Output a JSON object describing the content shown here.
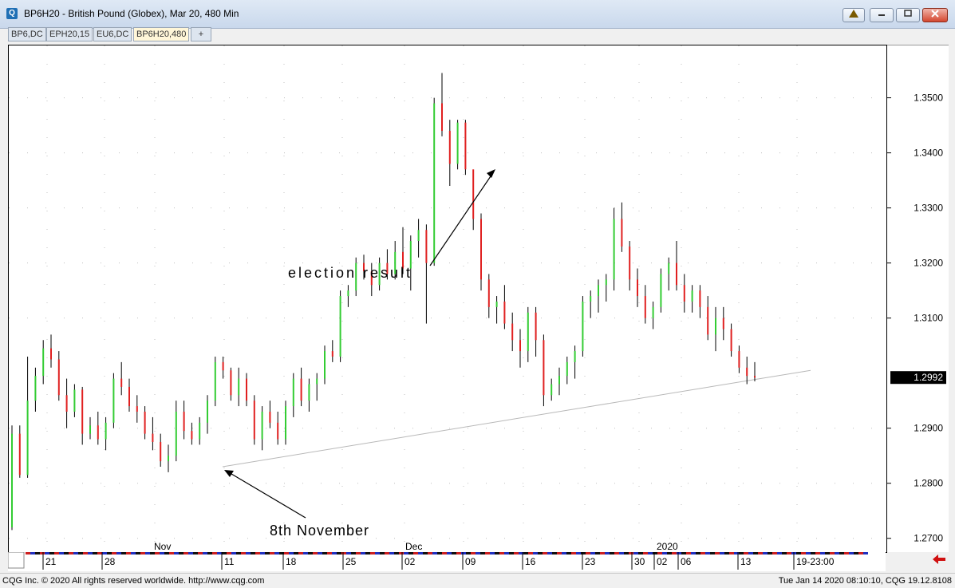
{
  "window": {
    "title": "BP6H20 - British Pound (Globex), Mar 20, 480 Min",
    "tabs": [
      "BP6,DC",
      "EPH20,15",
      "EU6,DC",
      "BP6H20,480"
    ],
    "add_tab": "+"
  },
  "chart_data": {
    "type": "candlestick",
    "symbol": "BP6H20",
    "y_ticks": [
      "1.3500",
      "1.3400",
      "1.3300",
      "1.3200",
      "1.3100",
      "1.2900",
      "1.2800",
      "1.2700"
    ],
    "y_ticks_values": [
      1.35,
      1.34,
      1.33,
      1.32,
      1.31,
      1.29,
      1.28,
      1.27
    ],
    "ylim": [
      1.2675,
      1.3595
    ],
    "last_price": "1.2992",
    "x_ticks_day": [
      "21",
      "28",
      "11",
      "18",
      "25",
      "02",
      "09",
      "16",
      "23",
      "30",
      "02",
      "06",
      "13",
      "19-23:00"
    ],
    "x_ticks_month": [
      "Nov",
      "Dec",
      "2020"
    ],
    "up_color": "#33cc33",
    "down_color": "#e02020",
    "annotations": [
      {
        "text": "election result"
      },
      {
        "text": "8th November"
      }
    ],
    "trendline": {
      "start": 1.283,
      "end": 1.3005
    },
    "bars": [
      [
        1.272,
        1.2905,
        1.2715,
        1.289
      ],
      [
        1.289,
        1.2905,
        1.281,
        1.2815
      ],
      [
        1.2815,
        1.303,
        1.281,
        1.295
      ],
      [
        1.295,
        1.301,
        1.293,
        1.2995
      ],
      [
        1.2995,
        1.306,
        1.298,
        1.3045
      ],
      [
        1.3045,
        1.307,
        1.301,
        1.3025
      ],
      [
        1.3025,
        1.304,
        1.295,
        1.296
      ],
      [
        1.296,
        1.299,
        1.29,
        1.293
      ],
      [
        1.293,
        1.298,
        1.292,
        1.297
      ],
      [
        1.297,
        1.2975,
        1.287,
        1.289
      ],
      [
        1.289,
        1.292,
        1.288,
        1.2905
      ],
      [
        1.2905,
        1.293,
        1.287,
        1.288
      ],
      [
        1.288,
        1.292,
        1.286,
        1.291
      ],
      [
        1.291,
        1.3,
        1.29,
        1.299
      ],
      [
        1.299,
        1.302,
        1.296,
        1.2975
      ],
      [
        1.2975,
        1.299,
        1.293,
        1.294
      ],
      [
        1.294,
        1.296,
        1.291,
        1.293
      ],
      [
        1.293,
        1.294,
        1.288,
        1.289
      ],
      [
        1.289,
        1.292,
        1.286,
        1.2875
      ],
      [
        1.2875,
        1.289,
        1.283,
        1.284
      ],
      [
        1.284,
        1.287,
        1.282,
        1.285
      ],
      [
        1.285,
        1.295,
        1.284,
        1.293
      ],
      [
        1.293,
        1.295,
        1.288,
        1.2895
      ],
      [
        1.2895,
        1.291,
        1.287,
        1.288
      ],
      [
        1.288,
        1.292,
        1.287,
        1.291
      ],
      [
        1.291,
        1.296,
        1.289,
        1.295
      ],
      [
        1.295,
        1.303,
        1.294,
        1.302
      ],
      [
        1.302,
        1.303,
        1.299,
        1.3005
      ],
      [
        1.3005,
        1.301,
        1.295,
        1.296
      ],
      [
        1.296,
        1.301,
        1.294,
        1.299
      ],
      [
        1.299,
        1.3,
        1.294,
        1.295
      ],
      [
        1.295,
        1.296,
        1.287,
        1.288
      ],
      [
        1.288,
        1.294,
        1.286,
        1.293
      ],
      [
        1.293,
        1.295,
        1.29,
        1.291
      ],
      [
        1.291,
        1.293,
        1.287,
        1.288
      ],
      [
        1.288,
        1.295,
        1.287,
        1.294
      ],
      [
        1.294,
        1.3,
        1.292,
        1.299
      ],
      [
        1.299,
        1.301,
        1.294,
        1.295
      ],
      [
        1.295,
        1.299,
        1.293,
        1.298
      ],
      [
        1.298,
        1.3,
        1.295,
        1.299
      ],
      [
        1.299,
        1.305,
        1.298,
        1.304
      ],
      [
        1.304,
        1.306,
        1.302,
        1.303
      ],
      [
        1.303,
        1.315,
        1.302,
        1.314
      ],
      [
        1.314,
        1.316,
        1.312,
        1.315
      ],
      [
        1.315,
        1.321,
        1.314,
        1.32
      ],
      [
        1.32,
        1.3215,
        1.317,
        1.3185
      ],
      [
        1.3185,
        1.32,
        1.314,
        1.316
      ],
      [
        1.316,
        1.321,
        1.315,
        1.32
      ],
      [
        1.32,
        1.3225,
        1.317,
        1.318
      ],
      [
        1.318,
        1.324,
        1.317,
        1.322
      ],
      [
        1.322,
        1.3265,
        1.318,
        1.319
      ],
      [
        1.319,
        1.325,
        1.315,
        1.324
      ],
      [
        1.324,
        1.328,
        1.321,
        1.326
      ],
      [
        1.326,
        1.327,
        1.309,
        1.32
      ],
      [
        1.32,
        1.35,
        1.3195,
        1.349
      ],
      [
        1.349,
        1.3545,
        1.343,
        1.344
      ],
      [
        1.344,
        1.346,
        1.334,
        1.338
      ],
      [
        1.338,
        1.346,
        1.337,
        1.3455
      ],
      [
        1.3455,
        1.346,
        1.336,
        1.337
      ],
      [
        1.337,
        1.334,
        1.326,
        1.328
      ],
      [
        1.328,
        1.329,
        1.315,
        1.317
      ],
      [
        1.317,
        1.318,
        1.31,
        1.312
      ],
      [
        1.312,
        1.314,
        1.309,
        1.313
      ],
      [
        1.313,
        1.316,
        1.308,
        1.309
      ],
      [
        1.309,
        1.311,
        1.304,
        1.306
      ],
      [
        1.306,
        1.308,
        1.301,
        1.304
      ],
      [
        1.304,
        1.312,
        1.302,
        1.311
      ],
      [
        1.311,
        1.312,
        1.303,
        1.306
      ],
      [
        1.306,
        1.307,
        1.294,
        1.296
      ],
      [
        1.296,
        1.299,
        1.295,
        1.298
      ],
      [
        1.298,
        1.301,
        1.296,
        1.2995
      ],
      [
        1.2995,
        1.303,
        1.298,
        1.302
      ],
      [
        1.302,
        1.305,
        1.299,
        1.304
      ],
      [
        1.304,
        1.314,
        1.303,
        1.313
      ],
      [
        1.313,
        1.315,
        1.31,
        1.314
      ],
      [
        1.314,
        1.317,
        1.311,
        1.316
      ],
      [
        1.316,
        1.318,
        1.313,
        1.317
      ],
      [
        1.317,
        1.33,
        1.315,
        1.328
      ],
      [
        1.328,
        1.331,
        1.322,
        1.323
      ],
      [
        1.323,
        1.324,
        1.315,
        1.317
      ],
      [
        1.317,
        1.319,
        1.312,
        1.314
      ],
      [
        1.314,
        1.316,
        1.309,
        1.31
      ],
      [
        1.31,
        1.313,
        1.308,
        1.312
      ],
      [
        1.312,
        1.319,
        1.311,
        1.318
      ],
      [
        1.318,
        1.321,
        1.315,
        1.32
      ],
      [
        1.32,
        1.324,
        1.315,
        1.316
      ],
      [
        1.316,
        1.318,
        1.311,
        1.313
      ],
      [
        1.313,
        1.316,
        1.311,
        1.315
      ],
      [
        1.315,
        1.316,
        1.31,
        1.312
      ],
      [
        1.312,
        1.314,
        1.306,
        1.307
      ],
      [
        1.307,
        1.312,
        1.304,
        1.31
      ],
      [
        1.31,
        1.312,
        1.306,
        1.308
      ],
      [
        1.308,
        1.309,
        1.303,
        1.304
      ],
      [
        1.304,
        1.305,
        1.3,
        1.301
      ],
      [
        1.301,
        1.303,
        1.298,
        1.2995
      ],
      [
        1.2995,
        1.302,
        1.2985,
        1.2992
      ]
    ]
  },
  "footer": {
    "left": "CQG Inc. © 2020 All rights reserved worldwide. http://www.cqg.com",
    "right": "Tue Jan 14 2020 08:10:10, CQG 19.12.8108"
  }
}
